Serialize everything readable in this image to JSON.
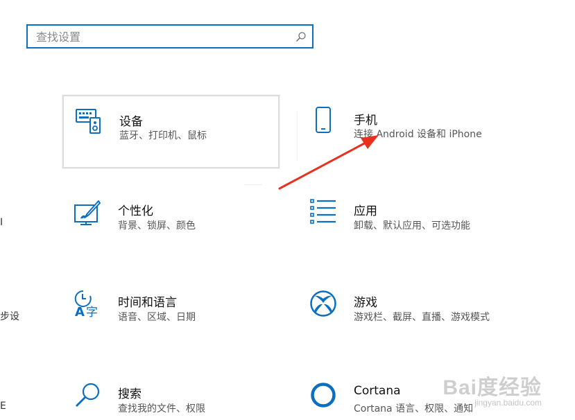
{
  "search": {
    "placeholder": "查找设置"
  },
  "tiles": [
    {
      "title": "设备",
      "desc": "蓝牙、打印机、鼠标",
      "icon": "devices-icon",
      "selected": true
    },
    {
      "title": "手机",
      "desc": "连接 Android 设备和 iPhone",
      "icon": "phone-icon",
      "selected": false
    },
    {
      "title": "个性化",
      "desc": "背景、锁屏、颜色",
      "icon": "personalization-icon",
      "selected": false
    },
    {
      "title": "应用",
      "desc": "卸载、默认应用、可选功能",
      "icon": "apps-icon",
      "selected": false
    },
    {
      "title": "时间和语言",
      "desc": "语音、区域、日期",
      "icon": "time-language-icon",
      "selected": false
    },
    {
      "title": "游戏",
      "desc": "游戏栏、截屏、直播、游戏模式",
      "icon": "xbox-icon",
      "selected": false
    },
    {
      "title": "搜索",
      "desc": "查找我的文件、权限",
      "icon": "search-icon",
      "selected": false
    },
    {
      "title": "Cortana",
      "desc": "Cortana 语言、权限、通知",
      "icon": "cortana-icon",
      "selected": false
    }
  ],
  "left_edge": {
    "row2": "I",
    "row3": "步设",
    "row4": "E"
  },
  "watermark": {
    "main": "Bai度经验",
    "sub": "jingyan.baidu.com"
  },
  "colors": {
    "accent": "#0a6fc2",
    "arrow": "#e8301f"
  }
}
